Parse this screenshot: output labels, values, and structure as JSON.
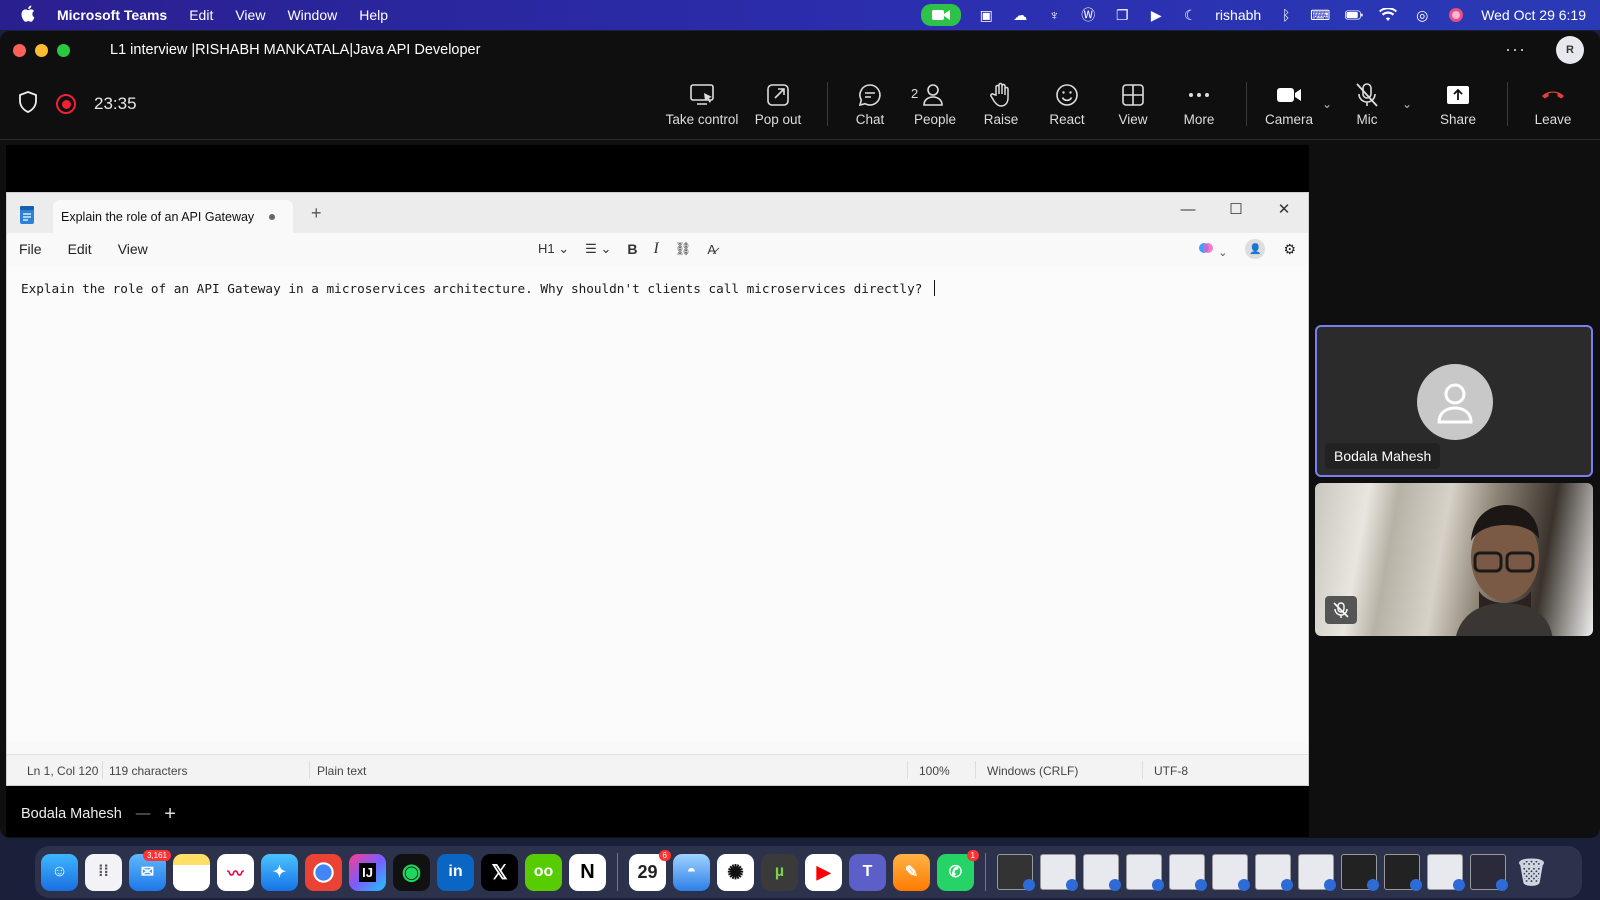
{
  "menubar": {
    "app_name": "Microsoft Teams",
    "menus": [
      "Edit",
      "View",
      "Window",
      "Help"
    ],
    "user": "rishabh",
    "datetime": "Wed Oct 29  6:19"
  },
  "window": {
    "title": "L1 interview |RISHABH MANKATALA|Java API Developer",
    "avatar_initial": "R"
  },
  "call": {
    "timer": "23:35",
    "people_count": "2",
    "controls": {
      "take_control": "Take control",
      "pop_out": "Pop out",
      "chat": "Chat",
      "people": "People",
      "raise": "Raise",
      "react": "React",
      "view": "View",
      "more": "More",
      "camera": "Camera",
      "mic": "Mic",
      "share": "Share",
      "leave": "Leave"
    }
  },
  "notepad": {
    "tab_title": "Explain the role of an API Gateway",
    "menu": [
      "File",
      "Edit",
      "View"
    ],
    "heading_select": "H1",
    "content": "Explain the role of an API Gateway in a microservices architecture. Why shouldn't clients call microservices directly? ",
    "status": {
      "position": "Ln 1, Col 120",
      "chars": "119 characters",
      "format": "Plain text",
      "zoom": "100%",
      "line_ending": "Windows (CRLF)",
      "encoding": "UTF-8"
    }
  },
  "presenter": {
    "name": "Bodala Mahesh"
  },
  "participants": [
    {
      "name": "Bodala Mahesh"
    }
  ],
  "dock": {
    "mail_badge": "3,161",
    "calendar_day": "29",
    "calendar_badge": "6",
    "whatsapp_badge": "1"
  },
  "colors": {
    "menubar": "#2b2fb0",
    "teams_bg": "#0f0f10",
    "active_tile_border": "#7b7ef0",
    "leave": "#e0413d",
    "record": "#e22233"
  }
}
